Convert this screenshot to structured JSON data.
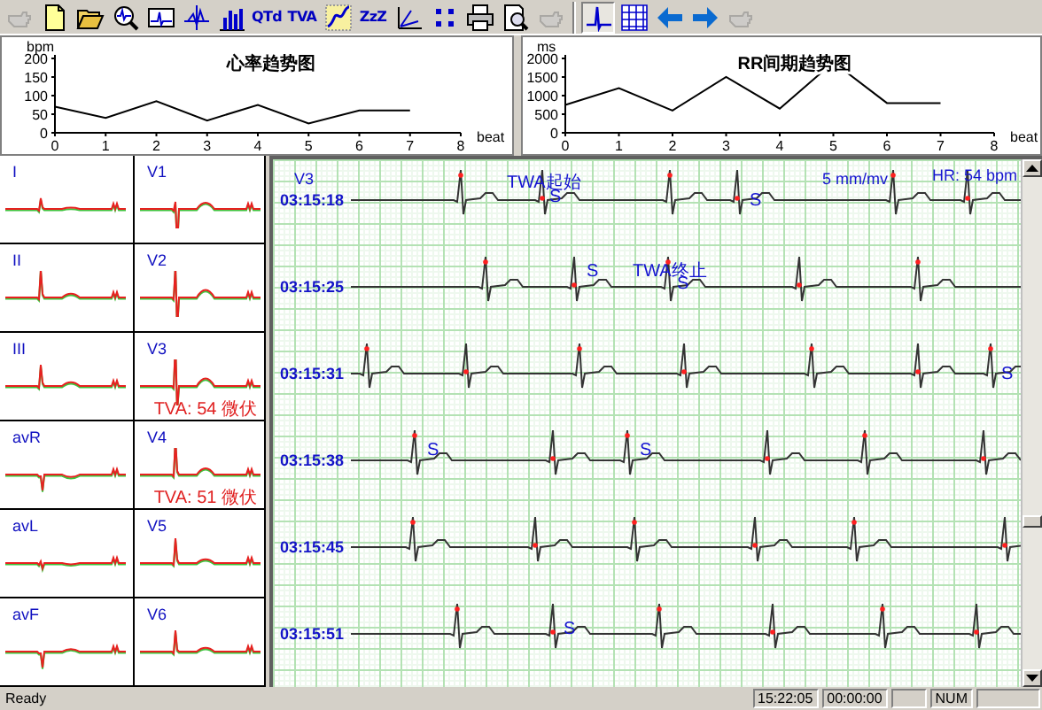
{
  "toolbar": {
    "groups": [
      {
        "buttons": [
          {
            "kind": "hand",
            "disabled": true,
            "pressed": false
          },
          {
            "kind": "new",
            "disabled": false,
            "pressed": false
          },
          {
            "kind": "open",
            "disabled": false,
            "pressed": false
          },
          {
            "kind": "zoom",
            "disabled": false,
            "pressed": false
          },
          {
            "kind": "monitor",
            "disabled": false,
            "pressed": false
          },
          {
            "kind": "axis",
            "disabled": false,
            "pressed": false
          },
          {
            "kind": "bars",
            "disabled": false,
            "pressed": false
          },
          {
            "kind": "text",
            "label": "QTd",
            "disabled": false,
            "pressed": false
          },
          {
            "kind": "text",
            "label": "TVA",
            "disabled": false,
            "pressed": false
          },
          {
            "kind": "scatter",
            "disabled": false,
            "pressed": false
          },
          {
            "kind": "text",
            "label": "ZzZ",
            "disabled": false,
            "pressed": false
          },
          {
            "kind": "angle",
            "disabled": false,
            "pressed": false
          },
          {
            "kind": "dots",
            "disabled": false,
            "pressed": false
          },
          {
            "kind": "print",
            "disabled": false,
            "pressed": false
          },
          {
            "kind": "preview",
            "disabled": false,
            "pressed": false
          },
          {
            "kind": "hand",
            "disabled": true,
            "pressed": false
          }
        ]
      },
      {
        "buttons": [
          {
            "kind": "ecg",
            "disabled": false,
            "pressed": true
          },
          {
            "kind": "grid",
            "disabled": false,
            "pressed": false
          },
          {
            "kind": "left",
            "disabled": false,
            "pressed": false
          },
          {
            "kind": "right",
            "disabled": false,
            "pressed": false
          },
          {
            "kind": "hand",
            "disabled": true,
            "pressed": false
          }
        ]
      }
    ]
  },
  "trend_charts": [
    {
      "chart_data": {
        "type": "line",
        "title": "心率趋势图",
        "xlabel": "beat",
        "ylabel": "bpm",
        "x": [
          0,
          1,
          2,
          3,
          4,
          5,
          6,
          7
        ],
        "xlim": [
          0,
          8
        ],
        "ylim": [
          0,
          200
        ],
        "xticks": [
          0,
          1,
          2,
          3,
          4,
          5,
          6,
          7,
          8
        ],
        "yticks": [
          0,
          50,
          100,
          150,
          200
        ],
        "series": [
          {
            "color": "#000000",
            "values": [
              70,
              40,
              85,
              33,
              75,
              25,
              60,
              60
            ]
          }
        ]
      }
    },
    {
      "chart_data": {
        "type": "line",
        "title": "RR间期趋势图",
        "xlabel": "beat",
        "ylabel": "ms",
        "x": [
          0,
          1,
          2,
          3,
          4,
          5,
          6,
          7
        ],
        "xlim": [
          0,
          8
        ],
        "ylim": [
          0,
          2000
        ],
        "xticks": [
          0,
          1,
          2,
          3,
          4,
          5,
          6,
          7,
          8
        ],
        "yticks": [
          0,
          500,
          1000,
          1500,
          2000
        ],
        "series": [
          {
            "color": "#000000",
            "values": [
              750,
              1200,
              600,
              1500,
              650,
              1900,
              800,
              800
            ]
          }
        ]
      }
    }
  ],
  "leads": [
    {
      "name": "I"
    },
    {
      "name": "V1"
    },
    {
      "name": "II"
    },
    {
      "name": "V2"
    },
    {
      "name": "III"
    },
    {
      "name": "V3",
      "twa": "TVA: 54 微伏"
    },
    {
      "name": "avR"
    },
    {
      "name": "V4",
      "twa": "TVA: 51 微伏"
    },
    {
      "name": "avL"
    },
    {
      "name": "V5"
    },
    {
      "name": "avF"
    },
    {
      "name": "V6"
    }
  ],
  "ecg_view": {
    "lead": "V3",
    "scale": "5 mm/mv",
    "heart_rate": "HR: 54 bpm",
    "strips": [
      {
        "time": "03:15:18",
        "marks": [
          {
            "text": "TWA起始"
          },
          {
            "text": "S"
          },
          {
            "text": "S"
          }
        ]
      },
      {
        "time": "03:15:25",
        "marks": [
          {
            "text": "S"
          },
          {
            "text": "TWA终止"
          },
          {
            "text": "S"
          }
        ]
      },
      {
        "time": "03:15:31",
        "marks": [
          {
            "text": "S"
          }
        ]
      },
      {
        "time": "03:15:38",
        "marks": [
          {
            "text": "S"
          },
          {
            "text": "S"
          }
        ]
      },
      {
        "time": "03:15:45"
      },
      {
        "time": "03:15:51",
        "marks": [
          {
            "text": "S"
          }
        ]
      }
    ]
  },
  "status_bar": {
    "message": "Ready",
    "panels": [
      "15:22:05",
      "00:00:00",
      "NUM"
    ]
  }
}
